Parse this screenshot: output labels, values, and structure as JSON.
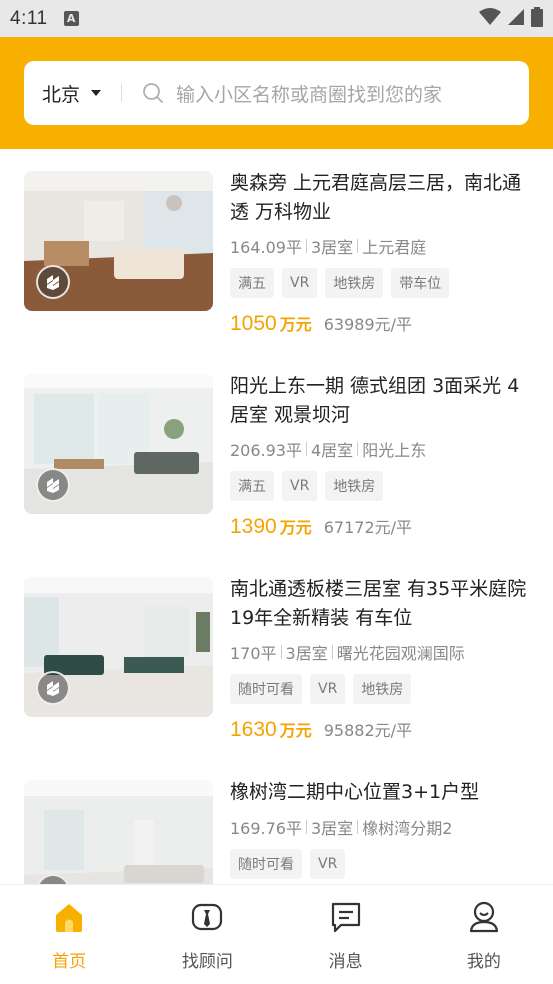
{
  "status_bar": {
    "time": "4:11",
    "notification_icon": "A"
  },
  "search": {
    "city": "北京",
    "placeholder": "输入小区名称或商圈找到您的家"
  },
  "listings": [
    {
      "title": "奥森旁 上元君庭高层三居，南北通透 万科物业",
      "area": "164.09平",
      "rooms": "3居室",
      "community": "上元君庭",
      "tags": [
        "满五",
        "VR",
        "地铁房",
        "带车位"
      ],
      "total_price": "1050",
      "price_unit": "万元",
      "unit_price": "63989元/平"
    },
    {
      "title": "阳光上东一期 德式组团 3面采光 4居室 观景坝河",
      "area": "206.93平",
      "rooms": "4居室",
      "community": "阳光上东",
      "tags": [
        "满五",
        "VR",
        "地铁房"
      ],
      "total_price": "1390",
      "price_unit": "万元",
      "unit_price": "67172元/平"
    },
    {
      "title": "南北通透板楼三居室 有35平米庭院 19年全新精装 有车位",
      "area": "170平",
      "rooms": "3居室",
      "community": "曙光花园观澜国际",
      "tags": [
        "随时可看",
        "VR",
        "地铁房"
      ],
      "total_price": "1630",
      "price_unit": "万元",
      "unit_price": "95882元/平"
    },
    {
      "title": "橡树湾二期中心位置3+1户型",
      "area": "169.76平",
      "rooms": "3居室",
      "community": "橡树湾分期2",
      "tags": [
        "随时可看",
        "VR"
      ],
      "total_price": "",
      "price_unit": "",
      "unit_price": ""
    }
  ],
  "tabs": [
    {
      "label": "首页",
      "icon": "home-icon",
      "active": true
    },
    {
      "label": "找顾问",
      "icon": "advisor-icon",
      "active": false
    },
    {
      "label": "消息",
      "icon": "message-icon",
      "active": false
    },
    {
      "label": "我的",
      "icon": "profile-icon",
      "active": false
    }
  ],
  "colors": {
    "accent": "#f8b000",
    "price": "#f5a300",
    "tag_bg": "#f3f3f3"
  }
}
